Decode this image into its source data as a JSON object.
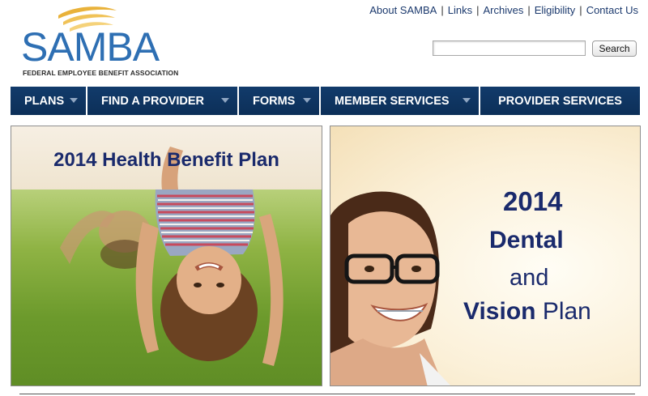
{
  "top_links": [
    "About SAMBA",
    "Links",
    "Archives",
    "Eligibility",
    "Contact Us"
  ],
  "logo": {
    "wordmark": "SAMBA",
    "tagline": "FEDERAL EMPLOYEE BENEFIT ASSOCIATION"
  },
  "search": {
    "value": "",
    "button_label": "Search"
  },
  "nav": {
    "items": [
      {
        "label": "PLANS",
        "has_dropdown": true
      },
      {
        "label": "FIND A PROVIDER",
        "has_dropdown": true
      },
      {
        "label": "FORMS",
        "has_dropdown": true
      },
      {
        "label": "MEMBER SERVICES",
        "has_dropdown": true
      },
      {
        "label": "PROVIDER SERVICES",
        "has_dropdown": false
      }
    ]
  },
  "banners": {
    "left": {
      "title": "2014 Health Benefit Plan"
    },
    "right": {
      "line1": "2014",
      "line2": "Dental",
      "line3": "and",
      "line4_bold": "Vision",
      "line4_rest": " Plan"
    }
  },
  "colors": {
    "nav_bg": "#0f3561",
    "brand_blue": "#2e6fb3",
    "title_navy": "#1a2a6c",
    "link": "#1c3a6e"
  }
}
